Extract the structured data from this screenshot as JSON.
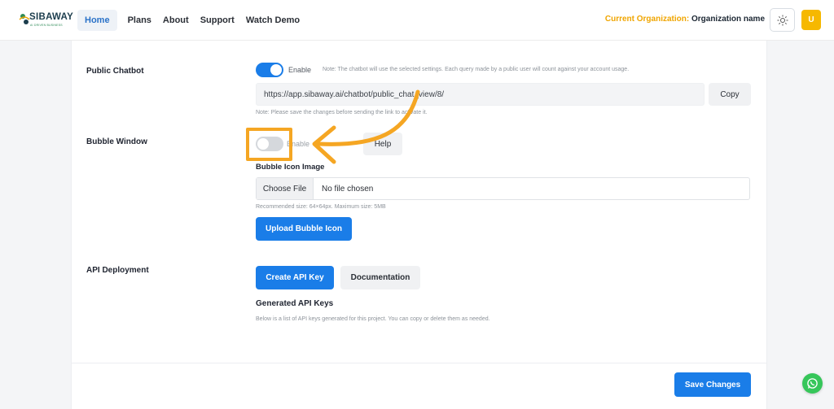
{
  "header": {
    "logo_text": "SIBAWAY",
    "logo_sub": "AI DRIVEN BUSINESS",
    "nav": [
      {
        "label": "Home",
        "active": true
      },
      {
        "label": "Plans",
        "active": false
      },
      {
        "label": "About",
        "active": false
      },
      {
        "label": "Support",
        "active": false
      },
      {
        "label": "Watch Demo",
        "active": false
      }
    ],
    "org_label": "Current Organization:",
    "org_value": "Organization name",
    "theme_icon": "sun-icon",
    "avatar_letter": "U"
  },
  "public_chatbot": {
    "label": "Public Chatbot",
    "toggle_on": true,
    "enable_label": "Enable",
    "enable_note": "Note: The chatbot will use the selected settings. Each query made by a public user will count against your account usage.",
    "url": "https://app.sibaway.ai/chatbot/public_chat_view/8/",
    "copy_label": "Copy",
    "save_note": "Note: Please save the changes before sending the link to activate it."
  },
  "bubble_window": {
    "label": "Bubble Window",
    "toggle_on": false,
    "enable_label": "Enable",
    "help_label": "Help",
    "icon_image_label": "Bubble Icon Image",
    "choose_file_label": "Choose File",
    "file_status": "No file chosen",
    "size_note": "Recommended size: 64×64px. Maximum size: 5MB",
    "upload_label": "Upload Bubble Icon"
  },
  "api_deployment": {
    "label": "API Deployment",
    "create_key_label": "Create API Key",
    "documentation_label": "Documentation",
    "generated_heading": "Generated API Keys",
    "generated_note": "Below is a list of API keys generated for this project. You can copy or delete them as needed."
  },
  "footer": {
    "save_label": "Save Changes"
  },
  "colors": {
    "accent": "#1a7de8",
    "highlight": "#f5a623",
    "org_label": "#f0a500",
    "avatar": "#f6b800",
    "whatsapp": "#36c65a"
  },
  "whatsapp_icon": "whatsapp-icon"
}
